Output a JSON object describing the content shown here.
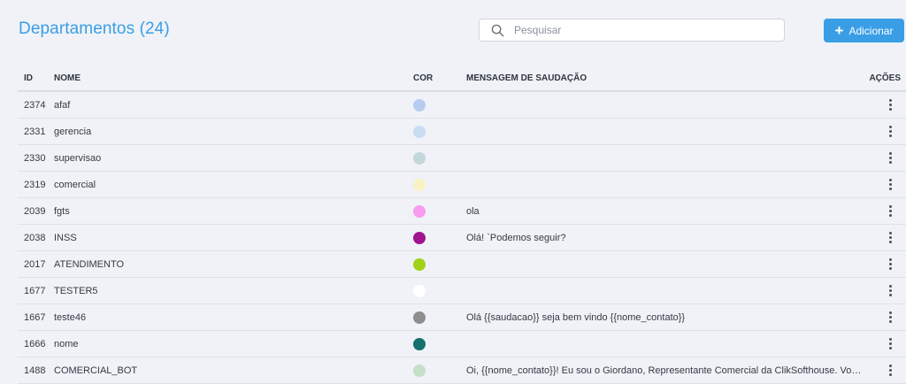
{
  "header": {
    "title": "Departamentos (24)",
    "search_placeholder": "Pesquisar",
    "add_label": "Adicionar"
  },
  "table": {
    "columns": {
      "id": "ID",
      "nome": "NOME",
      "cor": "COR",
      "mensagem": "MENSAGEM DE SAUDAÇÃO",
      "acoes": "AÇÕES"
    },
    "rows": [
      {
        "id": "2374",
        "nome": "afaf",
        "cor": "#b7cdf0",
        "mensagem": ""
      },
      {
        "id": "2331",
        "nome": "gerencia",
        "cor": "#c9dcf2",
        "mensagem": ""
      },
      {
        "id": "2330",
        "nome": "supervisao",
        "cor": "#c3d8da",
        "mensagem": ""
      },
      {
        "id": "2319",
        "nome": "comercial",
        "cor": "#faf1c4",
        "mensagem": ""
      },
      {
        "id": "2039",
        "nome": "fgts",
        "cor": "#f99af0",
        "mensagem": "ola"
      },
      {
        "id": "2038",
        "nome": "INSS",
        "cor": "#a0148f",
        "mensagem": "Olá! `Podemos seguir?"
      },
      {
        "id": "2017",
        "nome": "ATENDIMENTO",
        "cor": "#9fd11a",
        "mensagem": ""
      },
      {
        "id": "1677",
        "nome": "TESTER5",
        "cor": "#ffffff",
        "mensagem": ""
      },
      {
        "id": "1667",
        "nome": "teste46",
        "cor": "#8e8e8e",
        "mensagem": "Olá {{saudacao}} seja bem vindo {{nome_contato}}"
      },
      {
        "id": "1666",
        "nome": "nome",
        "cor": "#15706e",
        "mensagem": ""
      },
      {
        "id": "1488",
        "nome": "COMERCIAL_BOT",
        "cor": "#c4e0c6",
        "mensagem": "Oi, {{nome_contato}}! Eu sou o Giordano, Representante Comercial da ClikSofthouse. Vou te fa..."
      }
    ]
  }
}
